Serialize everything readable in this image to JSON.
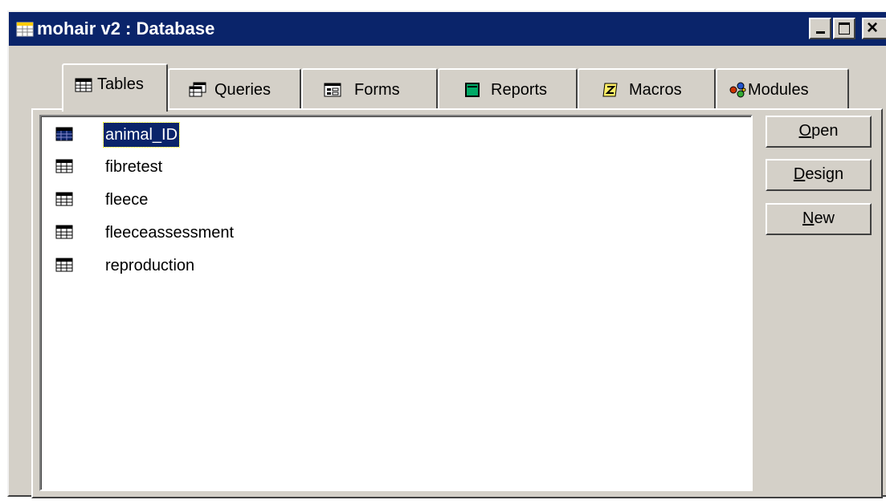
{
  "window": {
    "title": "mohair v2 : Database",
    "title_icon": "database-window-icon",
    "close_glyph": "×"
  },
  "tabs": [
    {
      "label": "Tables",
      "icon": "table-icon",
      "active": true
    },
    {
      "label": "Queries",
      "icon": "query-icon",
      "active": false
    },
    {
      "label": "Forms",
      "icon": "form-icon",
      "active": false
    },
    {
      "label": "Reports",
      "icon": "report-icon",
      "active": false
    },
    {
      "label": "Macros",
      "icon": "macro-icon",
      "active": false
    },
    {
      "label": "Modules",
      "icon": "module-icon",
      "active": false
    }
  ],
  "list": {
    "items": [
      {
        "label": "animal_ID",
        "selected": true
      },
      {
        "label": "fibretest",
        "selected": false
      },
      {
        "label": "fleece",
        "selected": false
      },
      {
        "label": "fleeceassessment",
        "selected": false
      },
      {
        "label": "reproduction",
        "selected": false
      }
    ]
  },
  "buttons": {
    "open": {
      "access_key": "O",
      "rest": "pen"
    },
    "design": {
      "access_key": "D",
      "rest": "esign"
    },
    "new": {
      "access_key": "N",
      "rest": "ew"
    }
  },
  "colors": {
    "titlebar": "#0a246a",
    "face": "#d4d0c8",
    "selection": "#0a246a"
  }
}
